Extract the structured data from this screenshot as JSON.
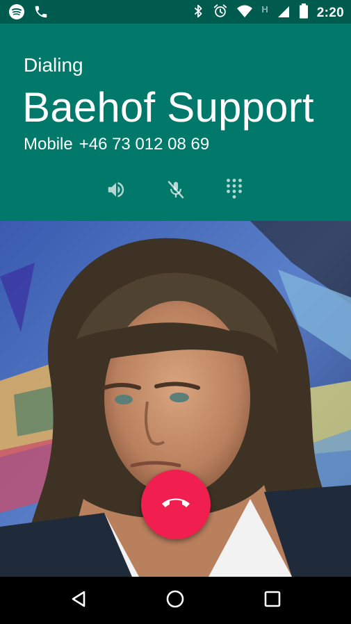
{
  "status_bar": {
    "time": "2:20",
    "network_badge": "H",
    "left_icons": [
      "spotify-icon",
      "phone-icon"
    ],
    "right_icons": [
      "bluetooth-icon",
      "alarm-icon",
      "wifi-icon",
      "cell-signal-icon",
      "battery-icon"
    ]
  },
  "call": {
    "state": "Dialing",
    "contact_name": "Baehof Support",
    "number_type": "Mobile",
    "number": "+46 73 012 08 69"
  },
  "controls": [
    "speaker-icon",
    "mute-microphone-icon",
    "dialpad-icon"
  ],
  "end_call": {
    "icon": "end-call-icon",
    "color": "#f11f4f"
  },
  "navigation": [
    "back-icon",
    "home-icon",
    "recents-icon"
  ],
  "colors": {
    "header": "#00796b",
    "status_bar": "#005b4f",
    "end_call": "#f11f4f"
  }
}
